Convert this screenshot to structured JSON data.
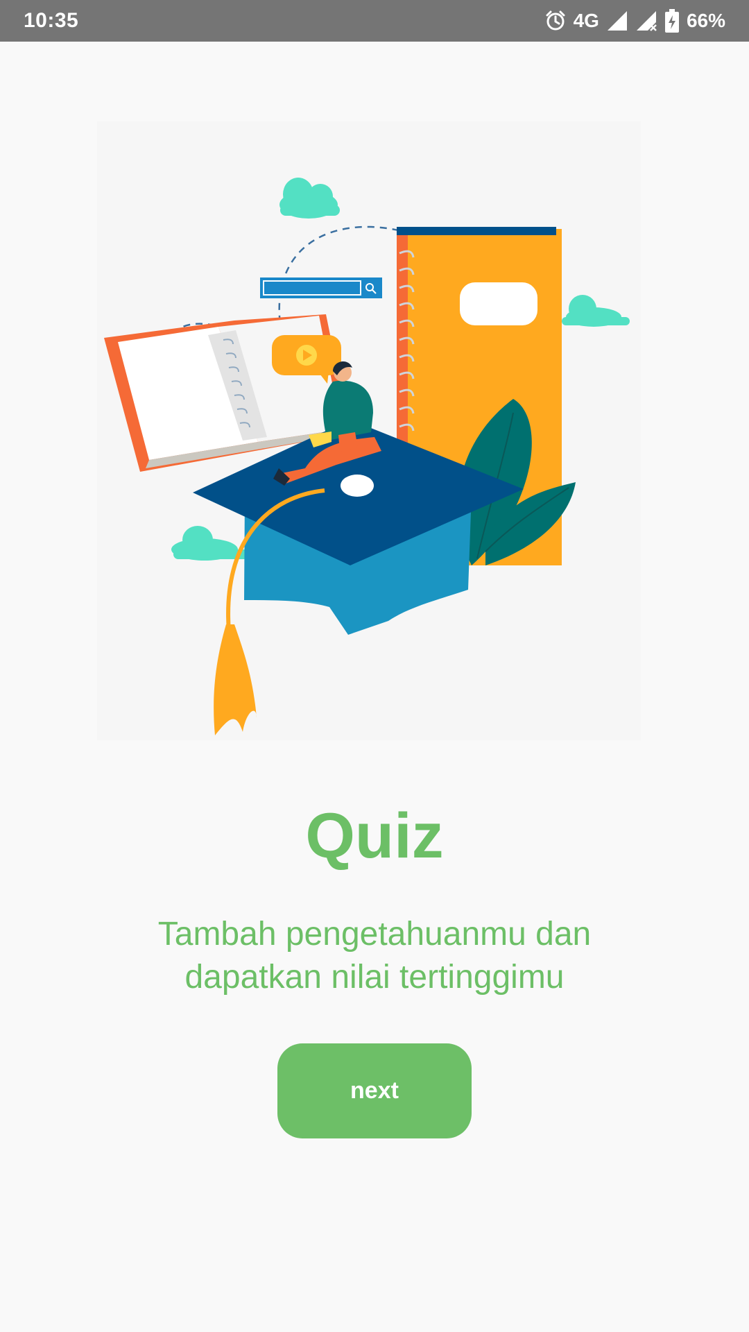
{
  "status_bar": {
    "time": "10:35",
    "network": "4G",
    "battery": "66%"
  },
  "screen": {
    "title": "Quiz",
    "subtitle": "Tambah pengetahuanmu dan dapatkan nilai tertinggimu",
    "next_label": "next"
  },
  "colors": {
    "accent_green": "#6cbf66",
    "status_bar": "#757575",
    "background": "#f9f9f9"
  },
  "icons": {
    "alarm": "alarm-icon",
    "signal": "signal-icon",
    "signal_no_data": "signal-x-icon",
    "battery": "battery-charging-icon"
  }
}
